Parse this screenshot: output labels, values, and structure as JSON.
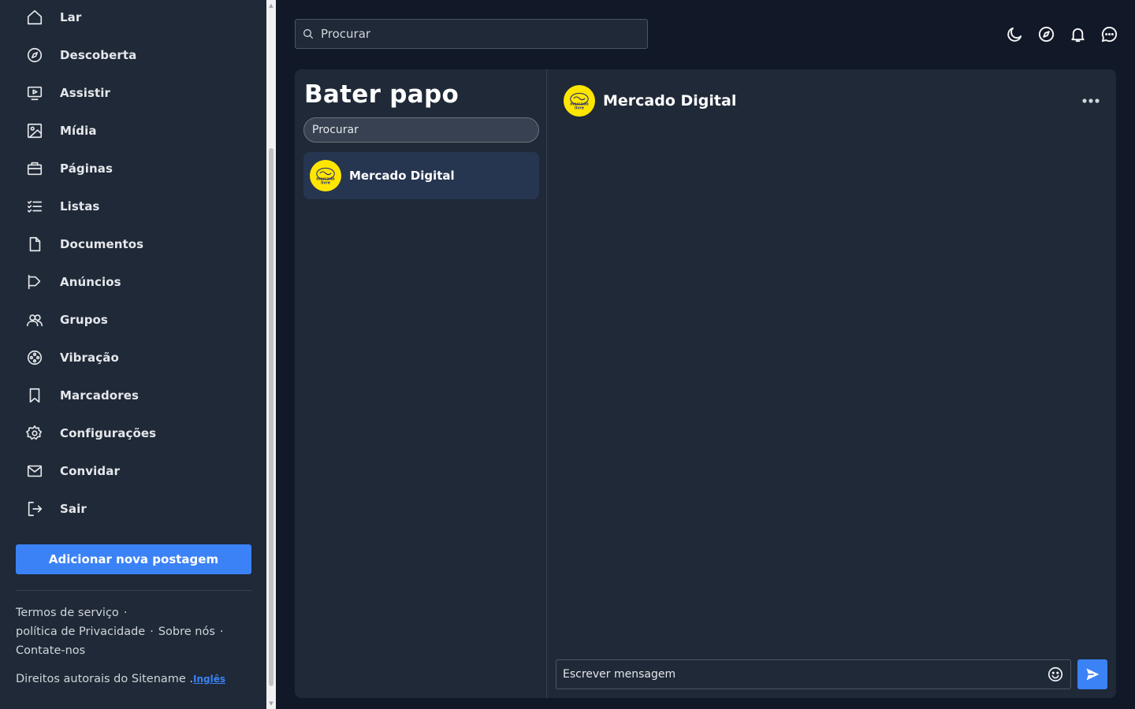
{
  "sidebar": {
    "items": [
      {
        "label": "Lar",
        "icon": "home-icon"
      },
      {
        "label": "Descoberta",
        "icon": "compass-icon"
      },
      {
        "label": "Assistir",
        "icon": "play-screen-icon"
      },
      {
        "label": "Mídia",
        "icon": "image-icon"
      },
      {
        "label": "Páginas",
        "icon": "briefcase-icon"
      },
      {
        "label": "Listas",
        "icon": "checklist-icon"
      },
      {
        "label": "Documentos",
        "icon": "document-icon"
      },
      {
        "label": "Anúncios",
        "icon": "megaphone-icon"
      },
      {
        "label": "Grupos",
        "icon": "users-icon"
      },
      {
        "label": "Vibração",
        "icon": "film-reel-icon"
      },
      {
        "label": "Marcadores",
        "icon": "bookmark-icon"
      },
      {
        "label": "Configurações",
        "icon": "gear-icon"
      },
      {
        "label": "Convidar",
        "icon": "mail-icon"
      },
      {
        "label": "Sair",
        "icon": "logout-icon"
      }
    ],
    "add_post_label": "Adicionar nova postagem",
    "footer": {
      "terms": "Termos de serviço",
      "privacy": "política de Privacidade",
      "about": "Sobre nós",
      "contact": "Contate-nos",
      "separator": "·",
      "copyright": "Direitos autorais do Sitename .",
      "language": "Inglês"
    }
  },
  "header": {
    "search_placeholder": "Procurar",
    "icons": [
      "moon-icon",
      "compass-icon",
      "bell-icon",
      "chat-icon"
    ]
  },
  "chat": {
    "title": "Bater papo",
    "search_placeholder": "Procurar",
    "conversations": [
      {
        "name": "Mercado Digital",
        "avatar_text": "mercado livre"
      }
    ],
    "active": {
      "name": "Mercado Digital"
    },
    "composer_placeholder": "Escrever mensagem"
  },
  "colors": {
    "background": "#111827",
    "panel": "#1f2937",
    "accent": "#3b82f6",
    "brand_yellow": "#ffe600"
  }
}
